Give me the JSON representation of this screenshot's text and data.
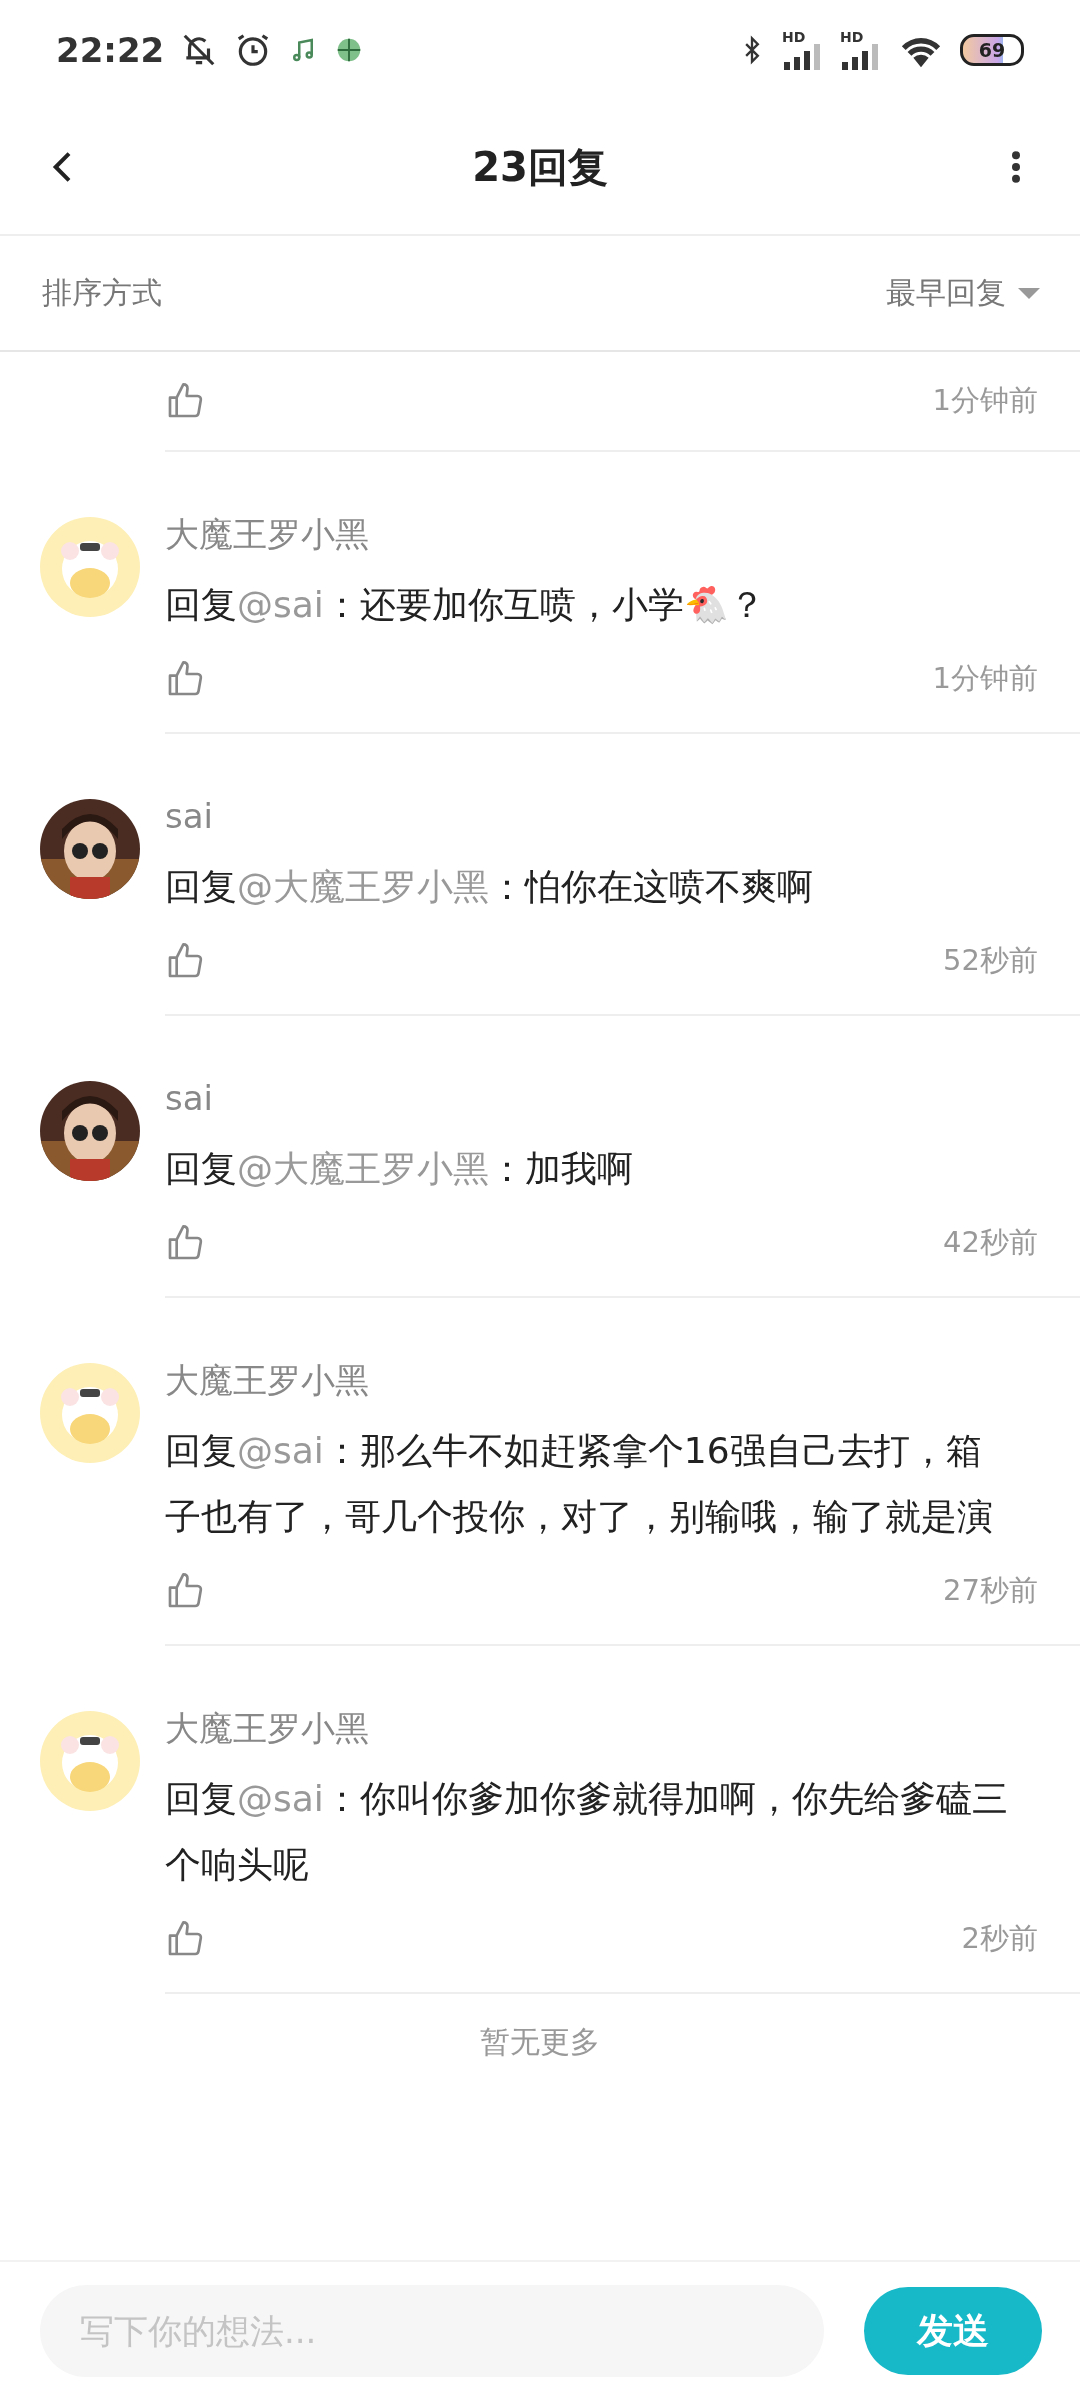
{
  "status_bar": {
    "time": "22:22",
    "battery": "69",
    "signal_labels": [
      "HD",
      "HD"
    ]
  },
  "header": {
    "title": "23回复"
  },
  "sort_bar": {
    "label": "排序方式",
    "value": "最早回复"
  },
  "comments": [
    {
      "kind": "tail",
      "time": "1分钟前"
    },
    {
      "kind": "comment",
      "author": "大魔王罗小黑",
      "reply_prefix": "回复",
      "mention": "@sai",
      "text": "：还要加你互喷，小学🐔？",
      "time": "1分钟前"
    },
    {
      "kind": "comment",
      "author": "sai",
      "reply_prefix": "回复",
      "mention": "@大魔王罗小黑",
      "text": "：怕你在这喷不爽啊",
      "time": "52秒前"
    },
    {
      "kind": "comment",
      "author": "sai",
      "reply_prefix": "回复",
      "mention": "@大魔王罗小黑",
      "text": "：加我啊",
      "time": "42秒前"
    },
    {
      "kind": "comment",
      "author": "大魔王罗小黑",
      "reply_prefix": "回复",
      "mention": "@sai",
      "text": "：那么牛不如赶紧拿个16强自己去打，箱子也有了，哥几个投你，对了，别输哦，输了就是演",
      "time": "27秒前"
    },
    {
      "kind": "comment",
      "author": "大魔王罗小黑",
      "reply_prefix": "回复",
      "mention": "@sai",
      "text": "：你叫你爹加你爹就得加啊，你先给爹磕三个响头呢",
      "time": "2秒前"
    }
  ],
  "end_note": "暂无更多",
  "composer": {
    "placeholder": "写下你的想法...",
    "send": "发送"
  }
}
